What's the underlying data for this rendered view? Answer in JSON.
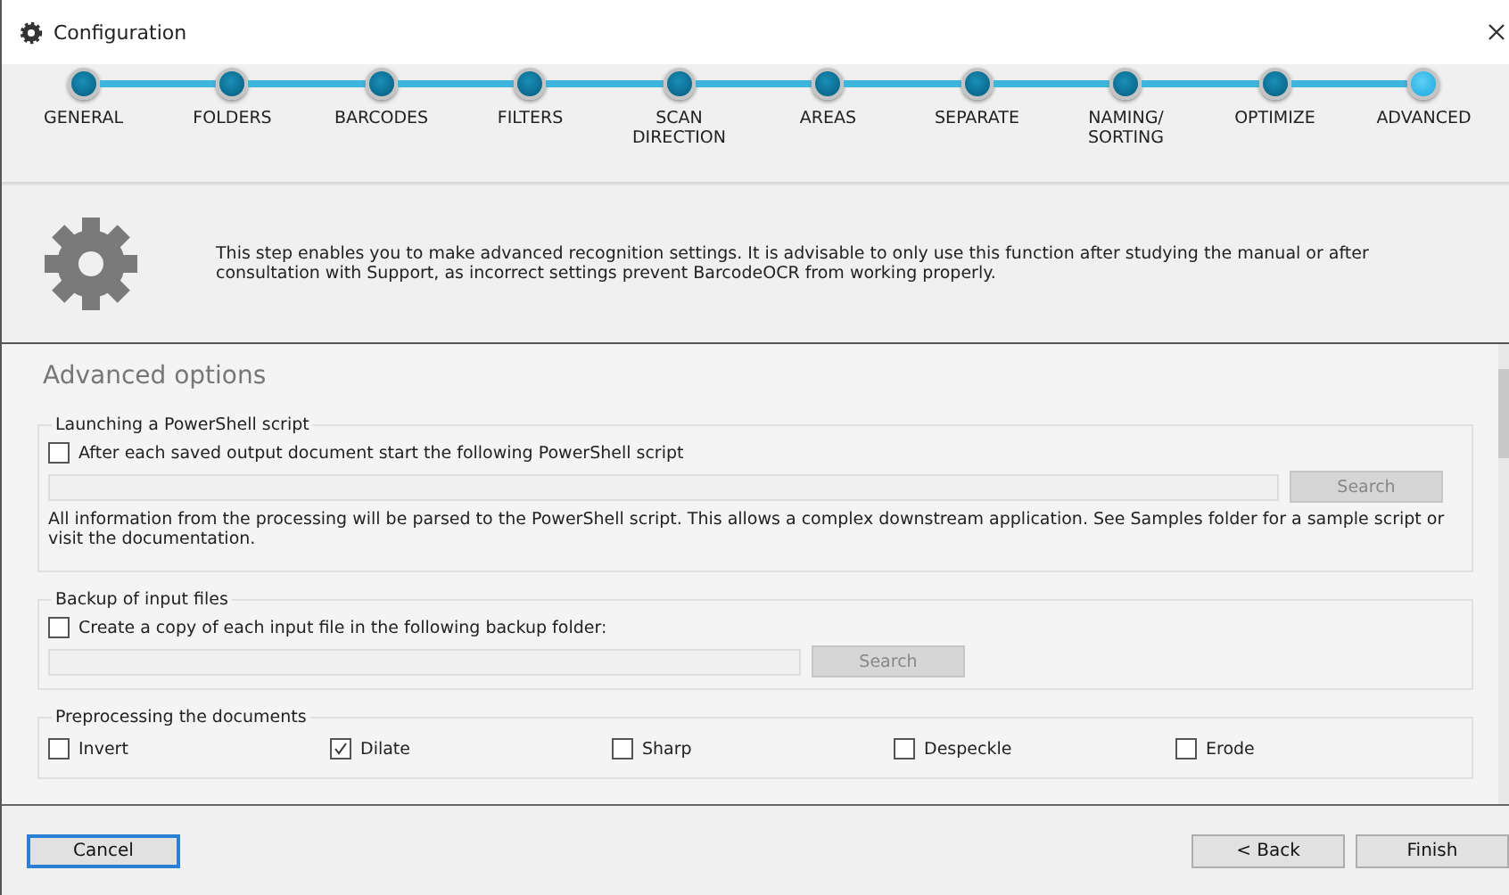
{
  "window": {
    "title": "Configuration"
  },
  "steps": [
    {
      "label": "GENERAL",
      "selected": false
    },
    {
      "label": "FOLDERS",
      "selected": false
    },
    {
      "label": "BARCODES",
      "selected": false
    },
    {
      "label": "FILTERS",
      "selected": false
    },
    {
      "label": "SCAN DIRECTION",
      "selected": false
    },
    {
      "label": "AREAS",
      "selected": false
    },
    {
      "label": "SEPARATE",
      "selected": false
    },
    {
      "label": "NAMING/ SORTING",
      "selected": false
    },
    {
      "label": "OPTIMIZE",
      "selected": false
    },
    {
      "label": "ADVANCED",
      "selected": true
    }
  ],
  "info": "This step enables you to make advanced recognition settings. It is advisable to only use this function after studying the manual or after consultation with Support, as incorrect settings prevent BarcodeOCR from working properly.",
  "heading": "Advanced options",
  "sections": [
    {
      "kind": "path",
      "title": "Launching a PowerShell script",
      "checkbox": {
        "label": "After each saved output document start the following PowerShell script",
        "checked": false
      },
      "button": "Search",
      "note": "All information from the processing will be parsed to the PowerShell script. This allows a complex downstream application. See Samples folder for a sample script or visit the documentation."
    },
    {
      "kind": "path",
      "title": "Backup of input files",
      "checkbox": {
        "label": "Create a copy of each input file in the following backup folder:",
        "checked": false
      },
      "button": "Search"
    },
    {
      "kind": "options",
      "title": "Preprocessing the documents",
      "options": [
        {
          "label": "Invert",
          "checked": false
        },
        {
          "label": "Dilate",
          "checked": true
        },
        {
          "label": "Sharp",
          "checked": false
        },
        {
          "label": "Despeckle",
          "checked": false
        },
        {
          "label": "Erode",
          "checked": false
        }
      ]
    }
  ],
  "footer": {
    "cancel": "Cancel",
    "back": "< Back",
    "finish": "Finish"
  }
}
